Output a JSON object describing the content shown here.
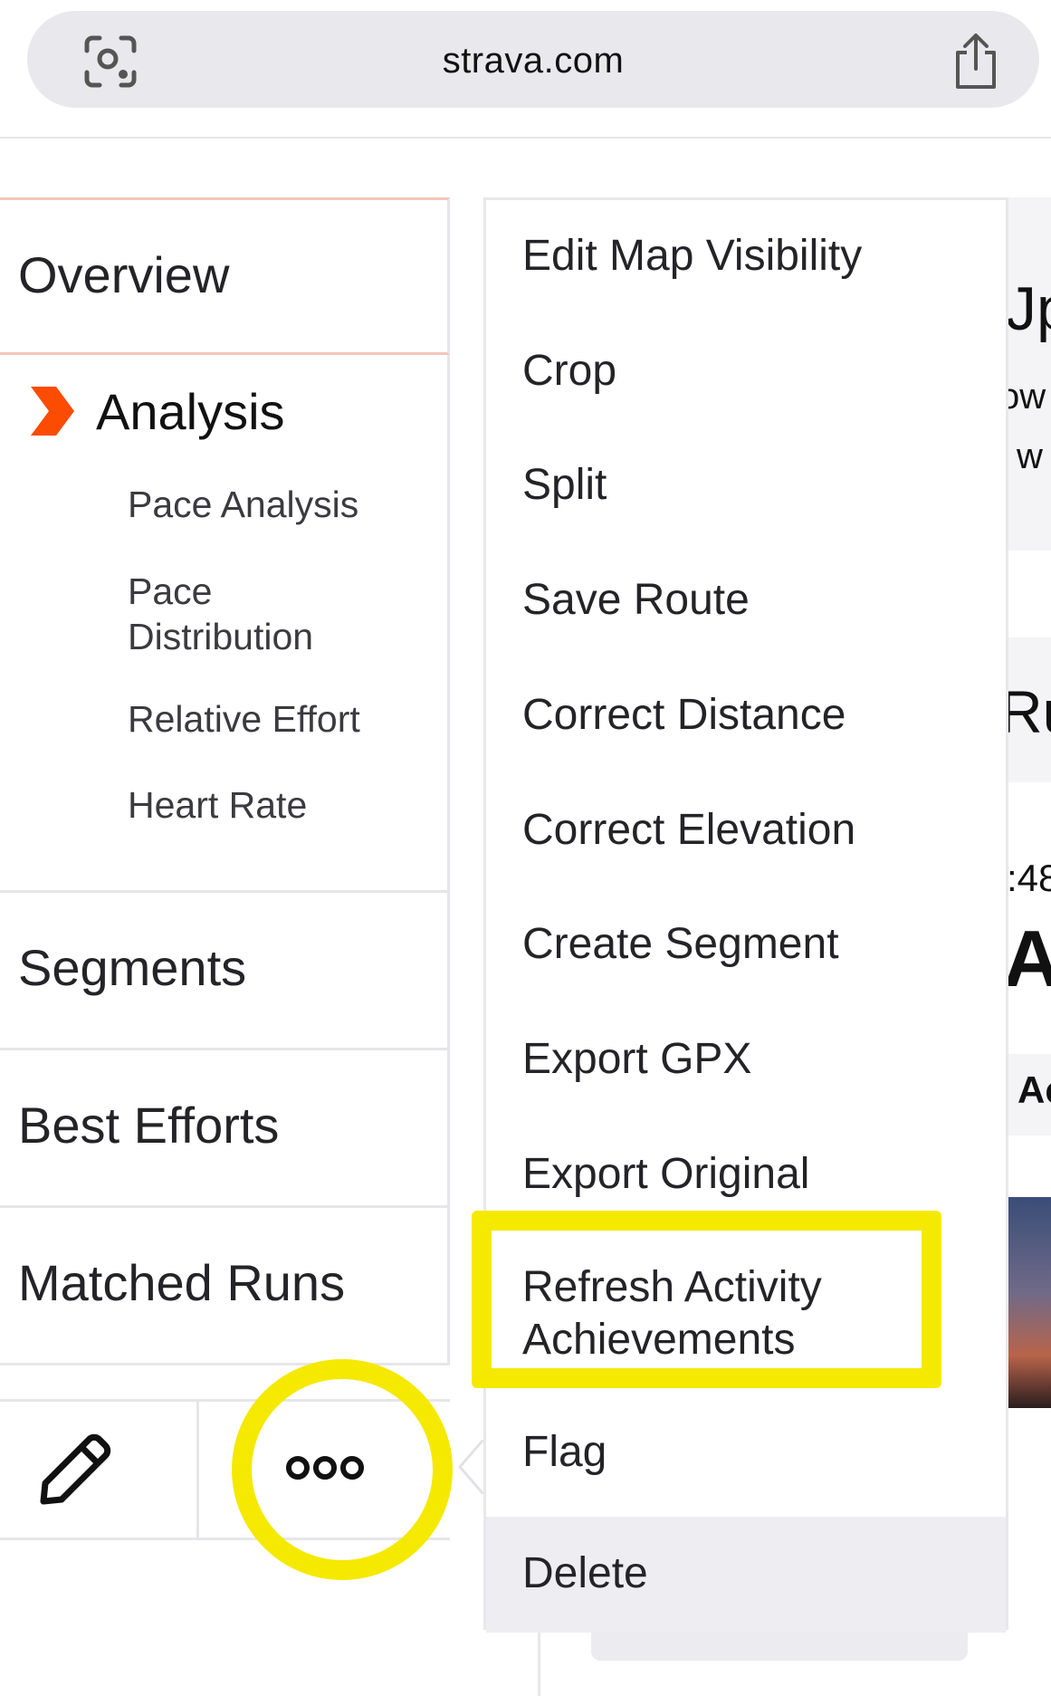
{
  "browser": {
    "url": "strava.com",
    "lens_icon": "lens-icon",
    "share_icon": "share-icon"
  },
  "nav": {
    "overview": "Overview",
    "analysis": {
      "label": "Analysis",
      "sub_items": [
        "Pace Analysis",
        "Pace Distribution",
        "Relative Effort",
        "Heart Rate"
      ]
    },
    "segments": "Segments",
    "best_efforts": "Best Efforts",
    "matched_runs": "Matched Runs"
  },
  "toolbar": {
    "edit_icon": "pencil-icon",
    "more_icon": "more-dots-icon"
  },
  "menu": {
    "items": [
      "Edit Map Visibility",
      "Crop",
      "Split",
      "Save Route",
      "Correct Distance",
      "Correct Elevation",
      "Create Segment",
      "Export GPX",
      "Export Original",
      "Refresh Activity Achievements",
      "Flag",
      "Delete"
    ],
    "highlighted_item": "Refresh Activity Achievements"
  },
  "background_fragments": [
    "Jp",
    "ow",
    "w",
    "Ru",
    ":48",
    "A",
    "Ac"
  ],
  "colors": {
    "accent": "#fc4c02",
    "highlight": "#f5e900",
    "menu_hover": "#eeeef2"
  }
}
